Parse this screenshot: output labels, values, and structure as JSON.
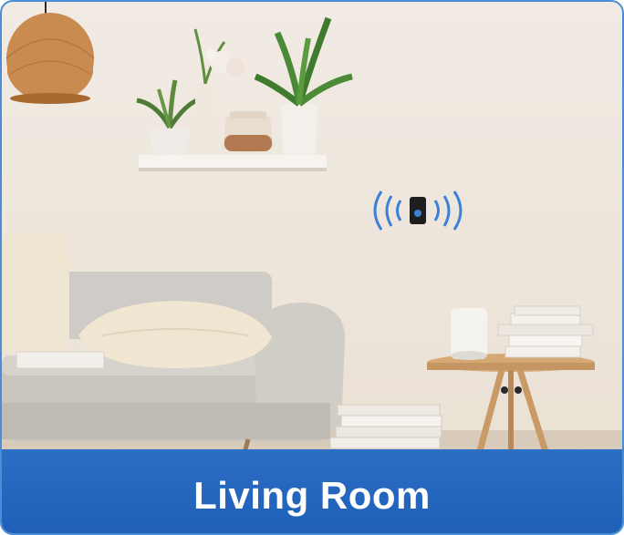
{
  "caption": {
    "text": "Living Room"
  },
  "colors": {
    "frame_border": "#4a8fd6",
    "caption_band": "#1f5fb8",
    "caption_text": "#ffffff",
    "wall": "#eee6dc",
    "signal_waves": "#3b82d6"
  },
  "device": {
    "icon": "wireless-doorbell-receiver-icon"
  }
}
